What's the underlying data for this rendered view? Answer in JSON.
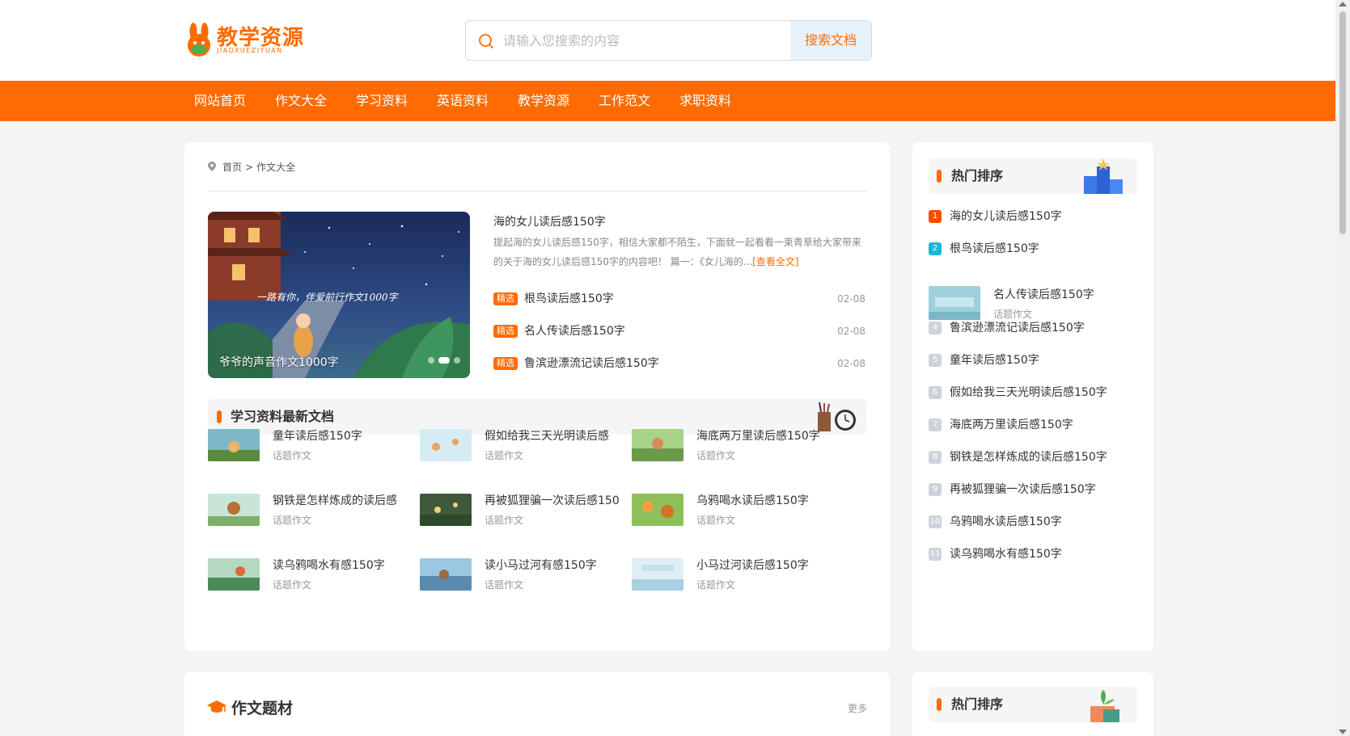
{
  "logo": {
    "text": "教学资源",
    "sub": "JIAOXUEZIYUAN"
  },
  "search": {
    "placeholder": "请输入您搜索的内容",
    "button": "搜索文档"
  },
  "nav": {
    "items": [
      "网站首页",
      "作文大全",
      "学习资料",
      "英语资料",
      "教学资源",
      "工作范文",
      "求职资料"
    ]
  },
  "breadcrumb": {
    "home": "首页",
    "sep": ">",
    "current": "作文大全"
  },
  "slider": {
    "caption": "爷爷的声音作文1000字",
    "banner_text": "一路有你，伴爱前行作文1000字",
    "dots": 3,
    "active_dot": 1
  },
  "featured": {
    "title": "海的女儿读后感150字",
    "desc": "提起海的女儿读后感150字，相信大家都不陌生，下面就一起看看一束青草给大家带来的关于海的女儿读后感150字的内容吧！ 篇一：《女儿海的...",
    "more": "[查看全文]"
  },
  "picks": [
    {
      "badge": "精选",
      "title": "根鸟读后感150字",
      "date": "02-08"
    },
    {
      "badge": "精选",
      "title": "名人传读后感150字",
      "date": "02-08"
    },
    {
      "badge": "精选",
      "title": "鲁滨逊漂流记读后感150字",
      "date": "02-08"
    }
  ],
  "latest": {
    "title": "学习资料最新文档",
    "items": [
      {
        "title": "童年读后感150字",
        "tag": "话题作文"
      },
      {
        "title": "假如给我三天光明读后感",
        "tag": "话题作文"
      },
      {
        "title": "海底两万里读后感150字",
        "tag": "话题作文"
      },
      {
        "title": "钢铁是怎样炼成的读后感",
        "tag": "话题作文"
      },
      {
        "title": "再被狐狸骗一次读后感150",
        "tag": "话题作文"
      },
      {
        "title": "乌鸦喝水读后感150字",
        "tag": "话题作文"
      },
      {
        "title": "读乌鸦喝水有感150字",
        "tag": "话题作文"
      },
      {
        "title": "读小马过河有感150字",
        "tag": "话题作文"
      },
      {
        "title": "小马过河读后感150字",
        "tag": "话题作文"
      }
    ]
  },
  "hot": {
    "title": "热门排序",
    "items": [
      {
        "num": "1",
        "title": "海的女儿读后感150字"
      },
      {
        "num": "2",
        "title": "根鸟读后感150字"
      },
      {
        "num": "4",
        "title": "鲁滨逊漂流记读后感150字"
      },
      {
        "num": "5",
        "title": "童年读后感150字"
      },
      {
        "num": "6",
        "title": "假如给我三天光明读后感150字"
      },
      {
        "num": "7",
        "title": "海底两万里读后感150字"
      },
      {
        "num": "8",
        "title": "钢铁是怎样炼成的读后感150字"
      },
      {
        "num": "9",
        "title": "再被狐狸骗一次读后感150字"
      },
      {
        "num": "10",
        "title": "乌鸦喝水读后感150字"
      },
      {
        "num": "11",
        "title": "读乌鸦喝水有感150字"
      }
    ],
    "feature": {
      "title": "名人传读后感150字",
      "tag": "话题作文"
    }
  },
  "topic": {
    "title": "作文题材",
    "more": "更多"
  },
  "hot2": {
    "title": "热门排序"
  },
  "colors": {
    "accent": "#ff6b00",
    "rank1": "#ff4d00",
    "rank2": "#17b8d3"
  }
}
